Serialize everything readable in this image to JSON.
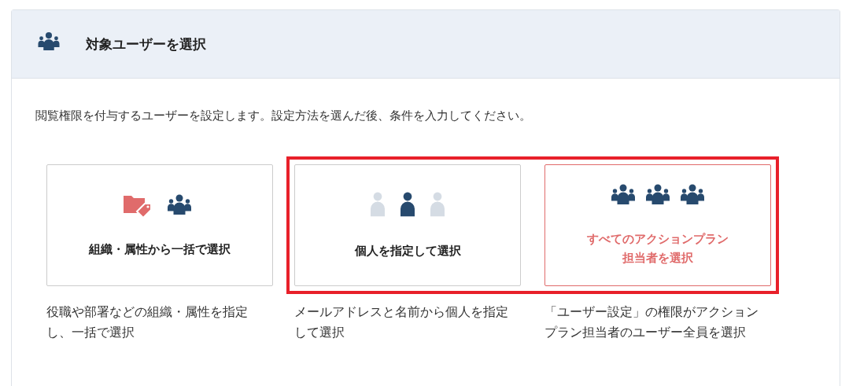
{
  "panel": {
    "title": "対象ユーザーを選択",
    "description": "閲覧権限を付与するユーザーを設定します。設定方法を選んだ後、条件を入力してください。"
  },
  "option_groups": [
    {
      "highlighted": false,
      "options": [
        {
          "kind": "organization",
          "title": [
            "組織・属性から一括で選択"
          ],
          "selected": false,
          "description": "役職や部署などの組織・属性を指定し、一括で選択"
        }
      ]
    },
    {
      "highlighted": true,
      "options": [
        {
          "kind": "individual",
          "title": [
            "個人を指定して選択"
          ],
          "selected": false,
          "description": "メールアドレスと名前から個人を指定して選択"
        },
        {
          "kind": "all",
          "title": [
            "すべてのアクションプラン",
            "担当者を選択"
          ],
          "selected": true,
          "description": "「ユーザー設定」の権限がアクションプラン担当者のユーザー全員を選択"
        }
      ]
    }
  ]
}
